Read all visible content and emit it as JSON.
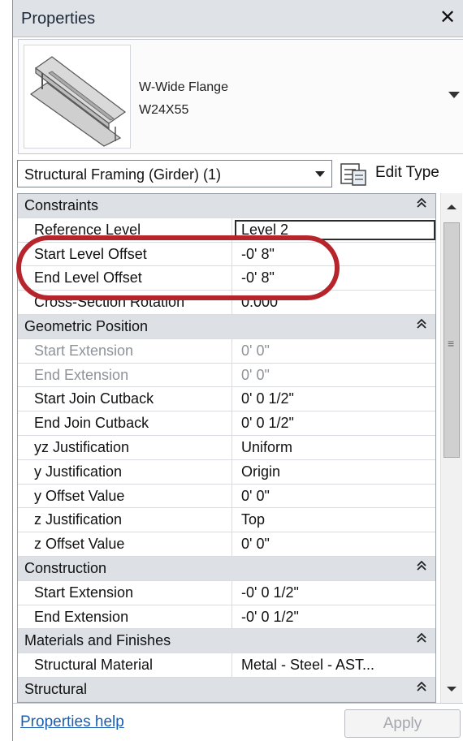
{
  "window": {
    "title": "Properties"
  },
  "type_selector": {
    "family": "W-Wide Flange",
    "type": "W24X55",
    "thumbnail_icon": "steel-beam-icon"
  },
  "filter": {
    "selected": "Structural Framing (Girder) (1)"
  },
  "edit_type": {
    "label": "Edit Type",
    "icon": "edit-type-icon"
  },
  "grid": {
    "rows": [
      {
        "kind": "group",
        "label": "Constraints"
      },
      {
        "kind": "param",
        "name": "Reference Level",
        "value": "Level 2",
        "editing": true
      },
      {
        "kind": "param",
        "name": "Start Level Offset",
        "value": "-0'  8\""
      },
      {
        "kind": "param",
        "name": "End Level Offset",
        "value": "-0'  8\""
      },
      {
        "kind": "param",
        "name": "Cross-Section Rotation",
        "value": "0.000°"
      },
      {
        "kind": "group",
        "label": "Geometric Position"
      },
      {
        "kind": "param",
        "name": "Start Extension",
        "value": "0'  0\"",
        "disabled": true
      },
      {
        "kind": "param",
        "name": "End Extension",
        "value": "0'  0\"",
        "disabled": true
      },
      {
        "kind": "param",
        "name": "Start Join Cutback",
        "value": "0'  0 1/2\""
      },
      {
        "kind": "param",
        "name": "End Join Cutback",
        "value": "0'  0 1/2\""
      },
      {
        "kind": "param",
        "name": "yz Justification",
        "value": "Uniform"
      },
      {
        "kind": "param",
        "name": "y Justification",
        "value": "Origin"
      },
      {
        "kind": "param",
        "name": "y Offset Value",
        "value": "0'  0\""
      },
      {
        "kind": "param",
        "name": "z Justification",
        "value": "Top"
      },
      {
        "kind": "param",
        "name": "z Offset Value",
        "value": "0'  0\""
      },
      {
        "kind": "group",
        "label": "Construction"
      },
      {
        "kind": "param",
        "name": "Start Extension",
        "value": "-0'  0 1/2\""
      },
      {
        "kind": "param",
        "name": "End Extension",
        "value": "-0'  0 1/2\""
      },
      {
        "kind": "group",
        "label": "Materials and Finishes"
      },
      {
        "kind": "param",
        "name": "Structural Material",
        "value": "Metal - Steel - AST..."
      },
      {
        "kind": "group",
        "label": "Structural"
      }
    ]
  },
  "footer": {
    "help_link": "Properties help",
    "apply_label": "Apply"
  },
  "colors": {
    "highlight": "#b6252c",
    "group_bg": "#dde1e6",
    "link": "#1a5fb4"
  }
}
